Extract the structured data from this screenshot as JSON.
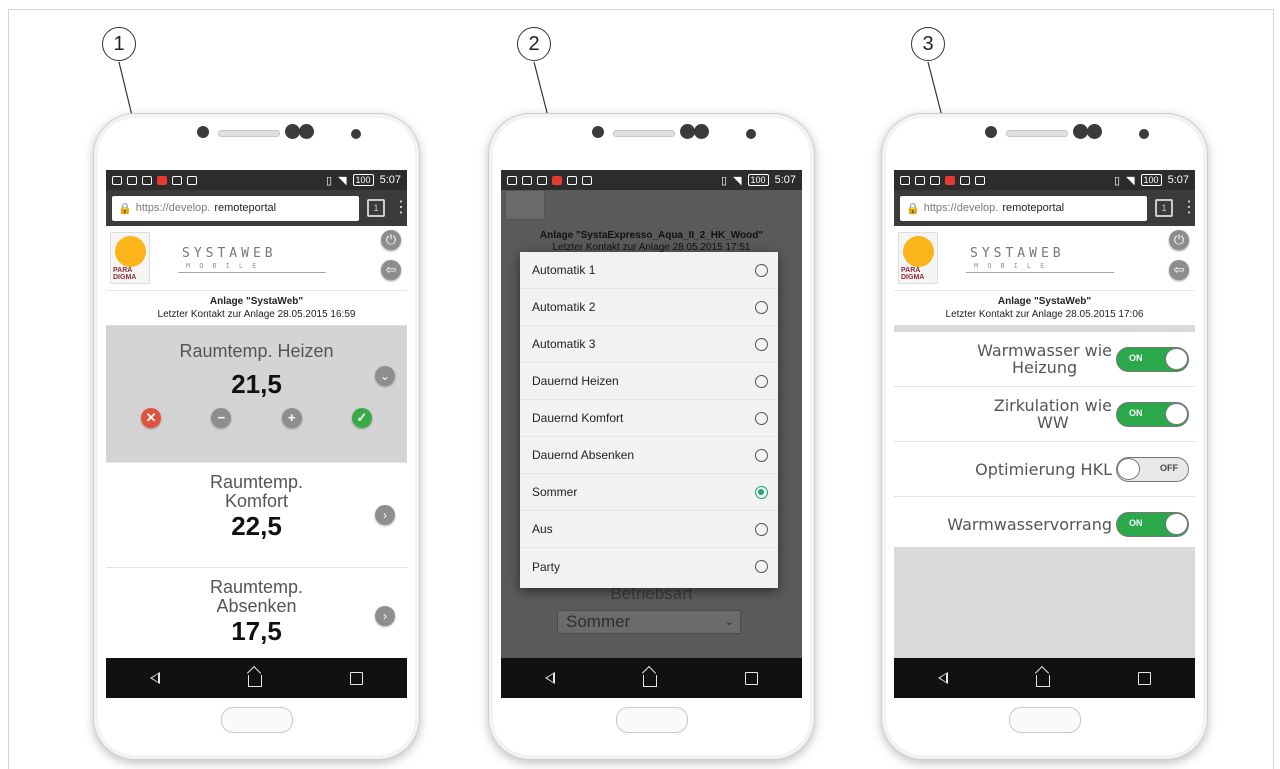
{
  "callouts": [
    "1",
    "2",
    "3"
  ],
  "statusbar": {
    "time": "5:07",
    "battery": "100"
  },
  "browser": {
    "url_prefix": "https://develop.",
    "url_domain": "remoteportal",
    "tab_count": "1"
  },
  "brand": {
    "name": "SYSTAWEB",
    "sub": "MOBILE",
    "logo_text": "PARA\nDIGMA"
  },
  "phone1": {
    "plant_name": "Anlage \"SystaWeb\"",
    "last_contact": "Letzter Kontakt zur Anlage 28.05.2015 16:59",
    "params": [
      {
        "label": "Raumtemp. Heizen",
        "value": "21,5"
      },
      {
        "label": "Raumtemp.\nKomfort",
        "value": "22,5"
      },
      {
        "label": "Raumtemp.\nAbsenken",
        "value": "17,5"
      }
    ]
  },
  "phone2": {
    "plant_name": "Anlage \"SystaExpresso_Aqua_II_2_HK_Wood\"",
    "last_contact": "Letzter Kontakt zur Anlage 28.05.2015 17:51",
    "options": [
      {
        "label": "Automatik 1",
        "selected": false
      },
      {
        "label": "Automatik 2",
        "selected": false
      },
      {
        "label": "Automatik 3",
        "selected": false
      },
      {
        "label": "Dauernd Heizen",
        "selected": false
      },
      {
        "label": "Dauernd Komfort",
        "selected": false
      },
      {
        "label": "Dauernd Absenken",
        "selected": false
      },
      {
        "label": "Sommer",
        "selected": true
      },
      {
        "label": "Aus",
        "selected": false
      },
      {
        "label": "Party",
        "selected": false
      }
    ],
    "mode_label": "Betriebsart",
    "mode_value": "Sommer"
  },
  "phone3": {
    "plant_name": "Anlage \"SystaWeb\"",
    "last_contact": "Letzter Kontakt zur Anlage 28.05.2015 17:06",
    "toggles": [
      {
        "label": "Warmwasser wie\nHeizung",
        "state": "ON"
      },
      {
        "label": "Zirkulation wie\nWW",
        "state": "ON"
      },
      {
        "label": "Optimierung HKL",
        "state": "OFF"
      },
      {
        "label": "Warmwasservorrang",
        "state": "ON"
      }
    ]
  },
  "colors": {
    "toggle_on": "#2aa84a",
    "radio_selected": "#1fa57a",
    "logo_sun": "#fbb41a",
    "cancel": "#e0533c",
    "confirm": "#3aaa46"
  }
}
